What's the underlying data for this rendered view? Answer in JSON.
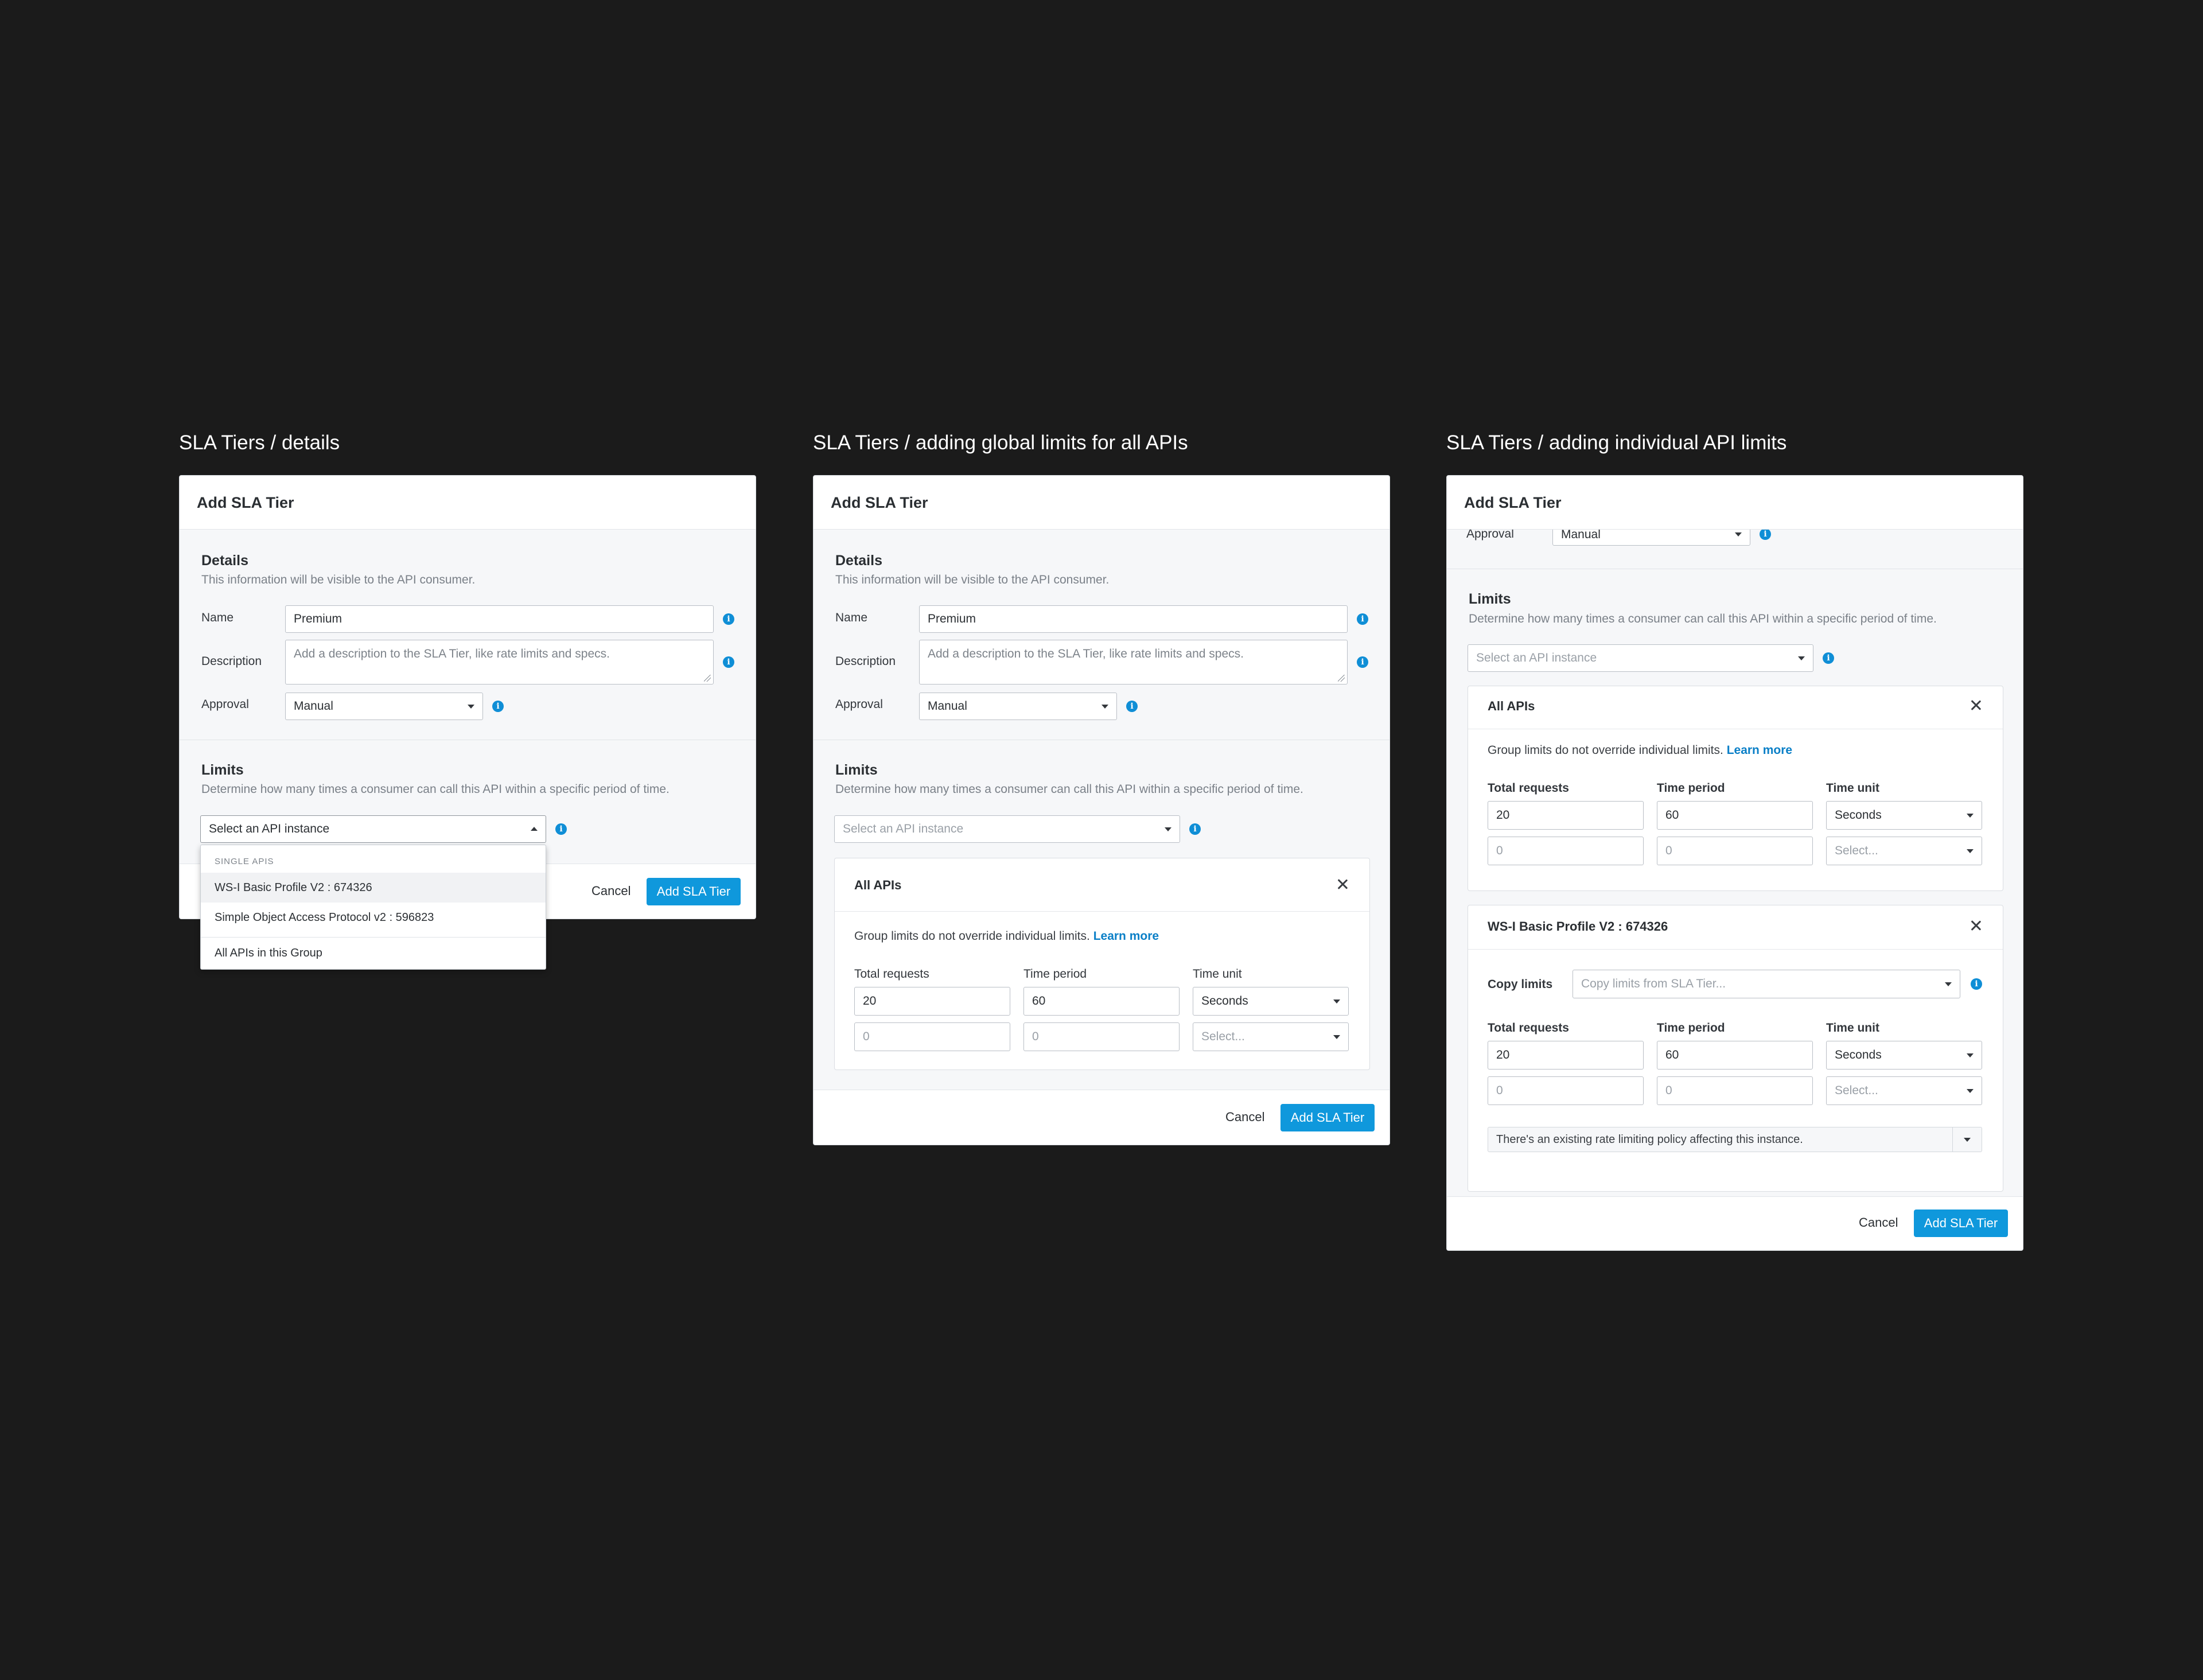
{
  "colors": {
    "background": "#1b1b1b",
    "accent": "#0f98dc",
    "link": "#0a7fc7"
  },
  "frames": [
    {
      "title": "SLA Tiers / details"
    },
    {
      "title": "SLA Tiers / adding global limits for all APIs"
    },
    {
      "title": "SLA Tiers / adding individual API limits"
    }
  ],
  "modal": {
    "title": "Add SLA Tier",
    "details": {
      "title": "Details",
      "subtitle": "This information will be visible to the API consumer.",
      "name_label": "Name",
      "name_value": "Premium",
      "description_label": "Description",
      "description_placeholder": "Add a description to the SLA Tier, like rate limits and specs.",
      "approval_label": "Approval",
      "approval_value": "Manual"
    },
    "limits": {
      "title": "Limits",
      "subtitle": "Determine how many times a consumer can call this API within a specific period of time.",
      "api_select_placeholder": "Select an API instance"
    },
    "dropdown": {
      "group_label": "SINGLE APIS",
      "items": [
        "WS-I Basic Profile V2 : 674326",
        "Simple Object Access Protocol v2 : 596823"
      ],
      "group_item": "All APIs in this Group"
    },
    "all_apis_card": {
      "title": "All APIs",
      "note": "Group limits do not override individual limits.",
      "learn_more": "Learn more"
    },
    "individual_card": {
      "title": "WS-I Basic Profile V2 : 674326",
      "copy_label": "Copy limits",
      "copy_placeholder": "Copy limits from SLA Tier...",
      "warning": "There's an existing rate limiting policy affecting this instance."
    },
    "limit_table": {
      "col_requests": "Total requests",
      "col_period": "Time period",
      "col_unit": "Time unit",
      "row1": {
        "requests": "20",
        "period": "60",
        "unit": "Seconds"
      },
      "row2": {
        "requests_placeholder": "0",
        "period_placeholder": "0",
        "unit_placeholder": "Select..."
      }
    },
    "footer": {
      "cancel": "Cancel",
      "submit": "Add SLA Tier"
    }
  }
}
